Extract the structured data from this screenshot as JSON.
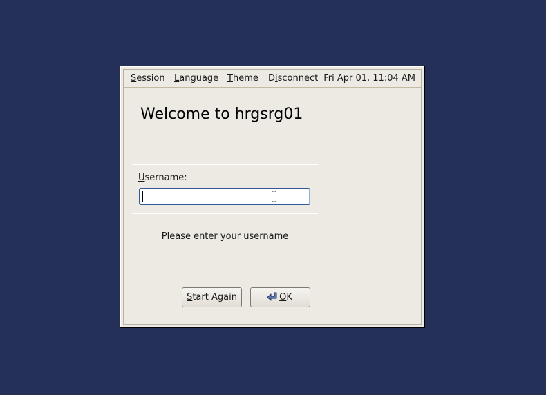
{
  "menubar": {
    "session": {
      "mnemonic": "S",
      "rest": "ession"
    },
    "language": {
      "mnemonic": "L",
      "rest": "anguage"
    },
    "theme": {
      "mnemonic": "T",
      "rest": "heme"
    },
    "disconnect": {
      "pre": "D",
      "mnemonic": "i",
      "rest": "sconnect"
    },
    "clock": "Fri Apr 01, 11:04 AM"
  },
  "welcome": "Welcome to hrgsrg01",
  "username": {
    "label_mnemonic": "U",
    "label_rest": "sername:",
    "value": ""
  },
  "prompt": "Please enter your username",
  "buttons": {
    "start_again": {
      "mnemonic": "S",
      "rest": "tart Again"
    },
    "ok": {
      "mnemonic": "O",
      "rest": "K",
      "icon": "enter-arrow-icon"
    }
  },
  "colors": {
    "desktop_background": "#243058",
    "dialog_background": "#edeae4",
    "input_focus_border": "#35579a"
  },
  "icons": {
    "text_cursor": "ibeam-cursor-icon"
  }
}
